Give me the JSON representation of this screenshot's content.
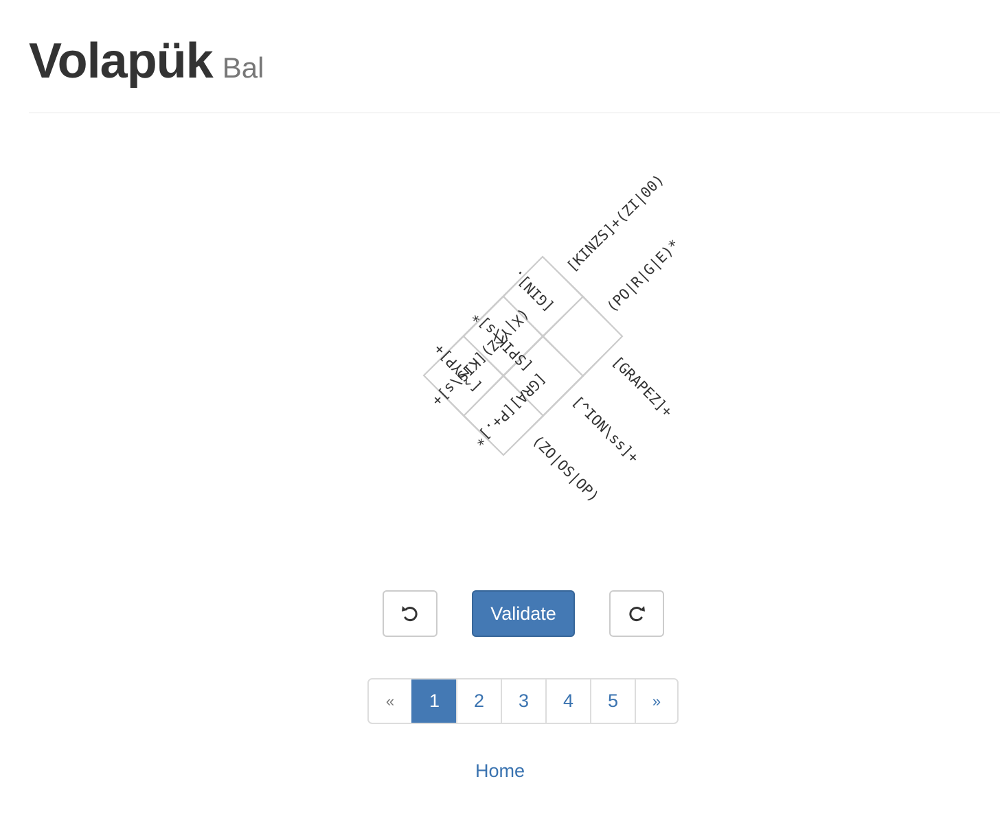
{
  "header": {
    "title": "Volapük",
    "subtitle": "Bal"
  },
  "puzzle": {
    "grid_size": "2x2",
    "clues": {
      "top_left": [
        "[^ZYP]+",
        "[SPIK\\s]*",
        "[GIN]."
      ],
      "top_right": [
        "[KINZS]+(ZI|00)",
        "(PO|R|G|E)*"
      ],
      "bottom_right": [
        "[GRAPEZ]+",
        "[^ION\\ss]+"
      ],
      "bottom": [
        "(ZO|OS|OP)"
      ],
      "bottom_left": [
        "(X|Y|Z)[KIS\\s]+",
        "[GRA][P+.]*"
      ]
    }
  },
  "controls": {
    "undo_icon": "undo-icon",
    "validate_label": "Validate",
    "redo_icon": "redo-icon"
  },
  "pagination": {
    "prev": "«",
    "pages": [
      "1",
      "2",
      "3",
      "4",
      "5"
    ],
    "active": "1",
    "next": "»"
  },
  "footer": {
    "home_label": "Home"
  }
}
